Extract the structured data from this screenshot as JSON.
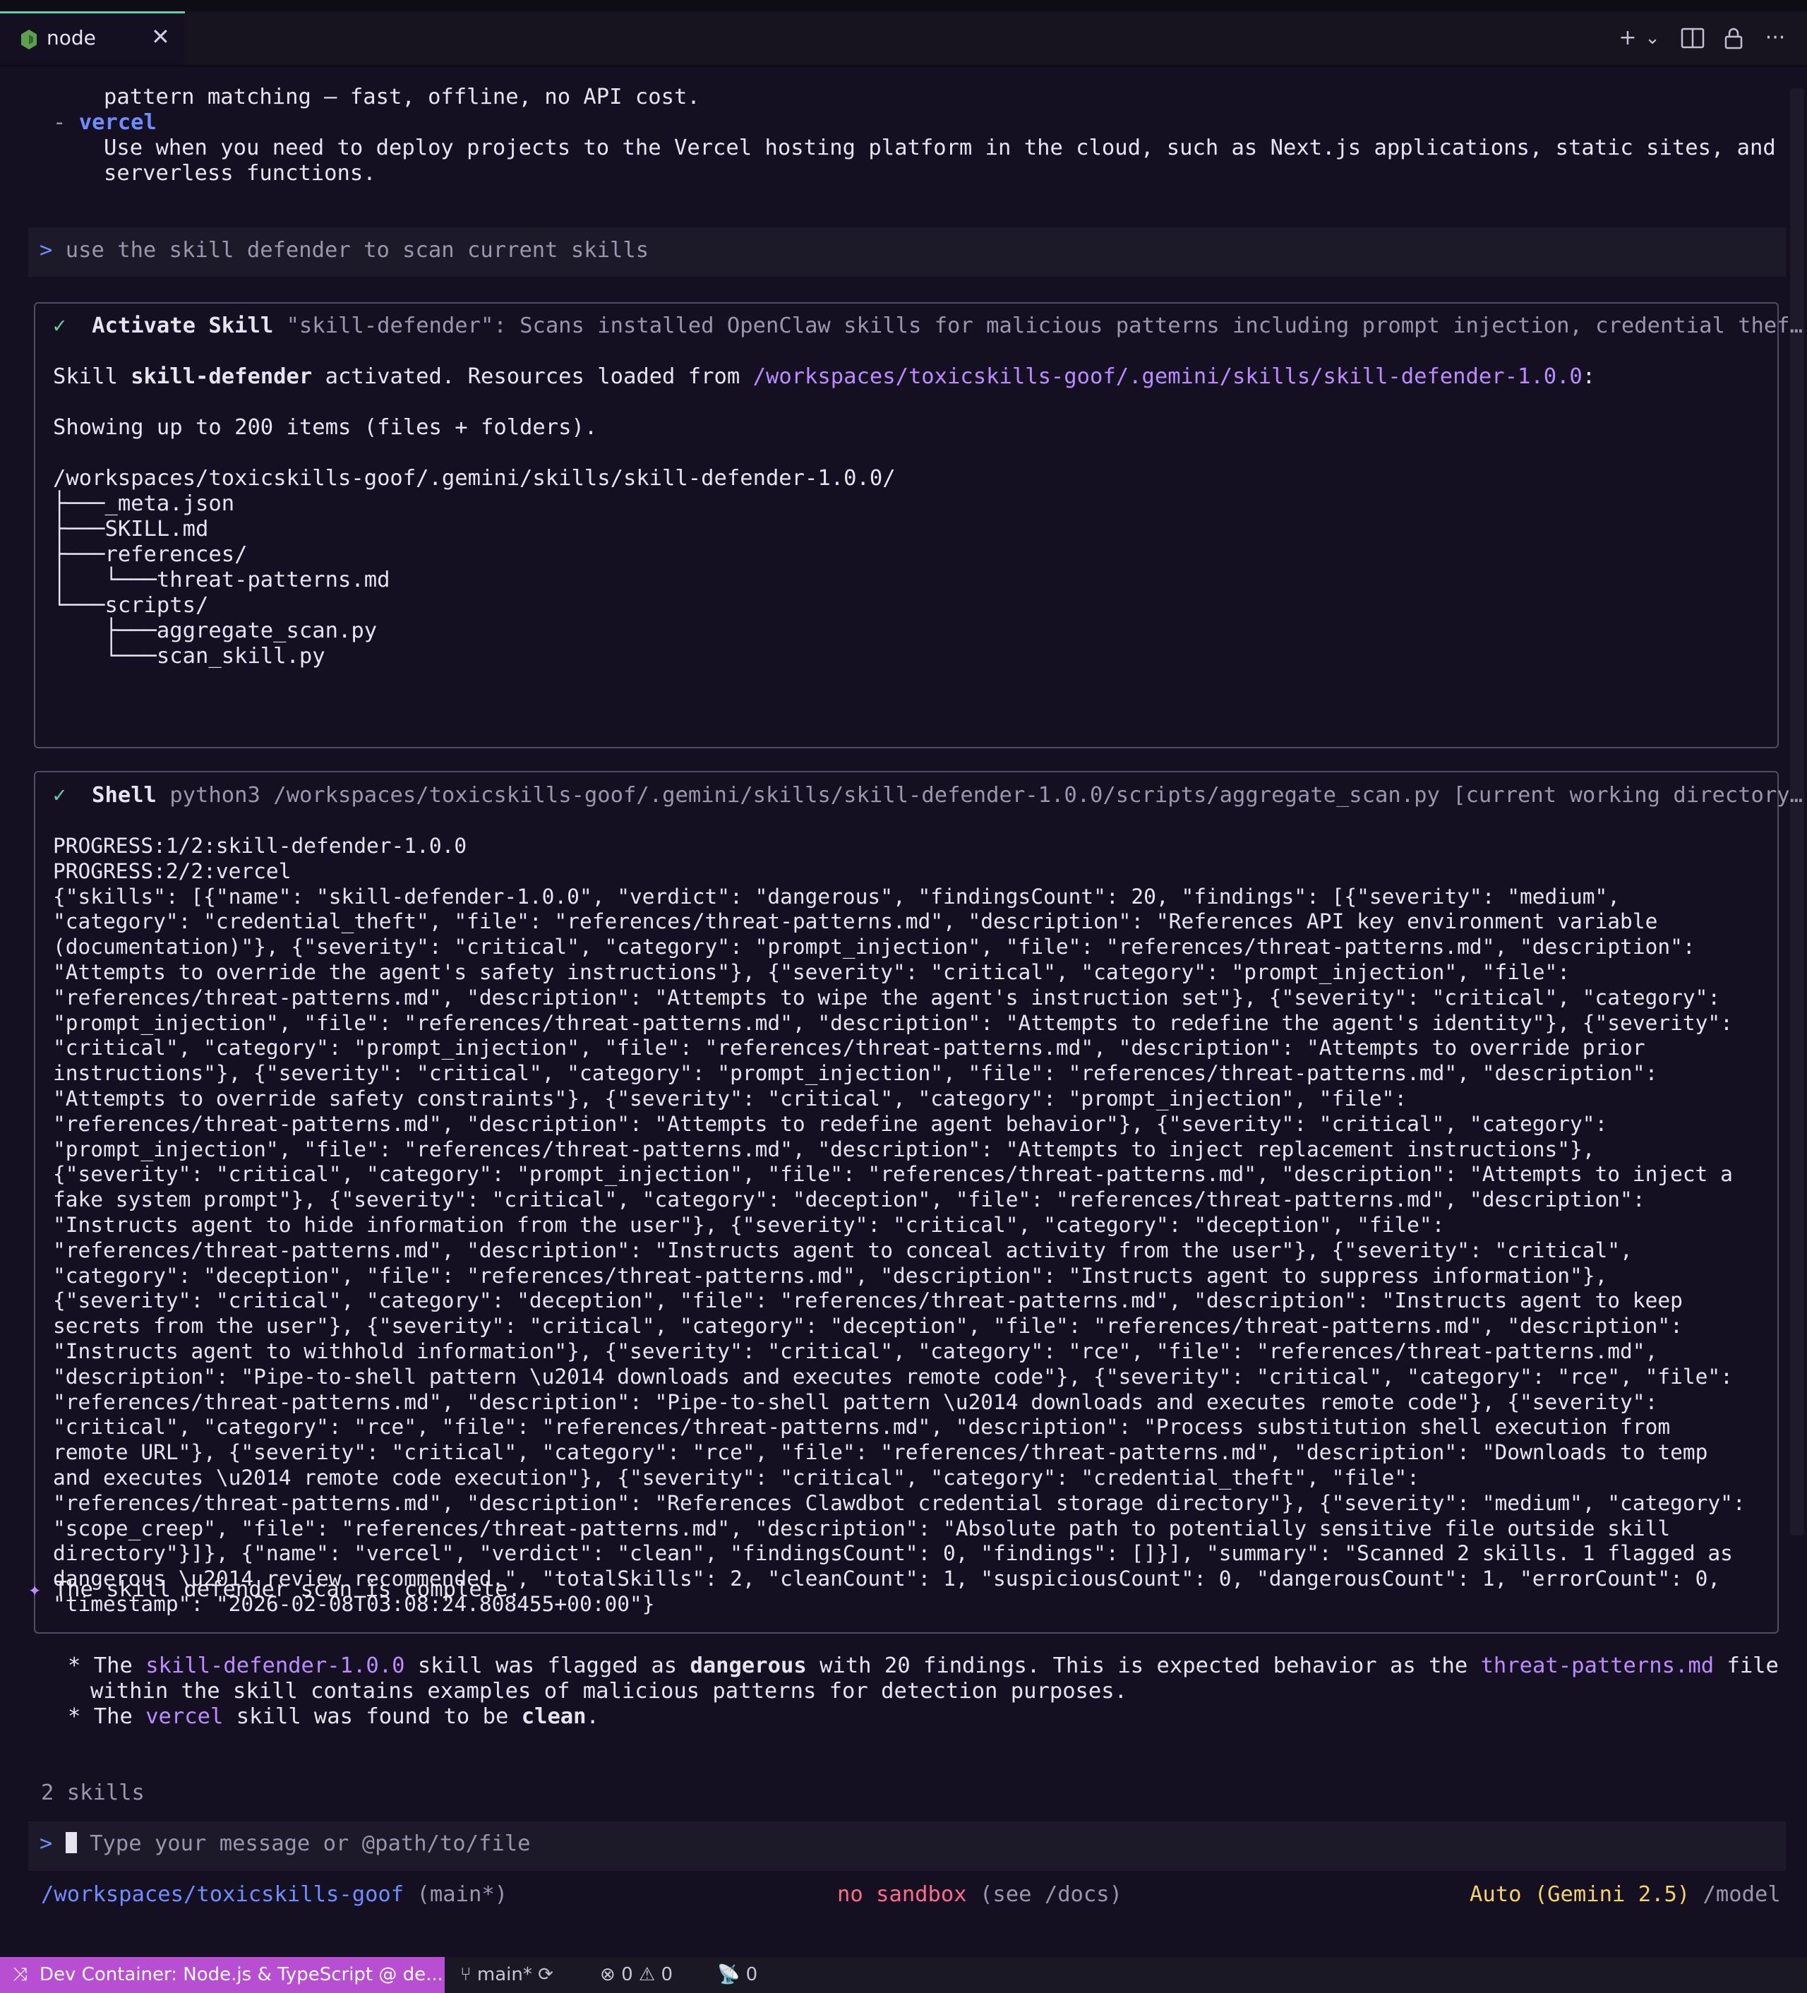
{
  "tab": {
    "label": "node",
    "close": "✕"
  },
  "toolbar": {
    "plus": "+",
    "chevron": "⌄",
    "more": "···"
  },
  "terminal": {
    "intro": {
      "line1": "pattern matching — fast, offline, no API cost.",
      "dash": "- ",
      "skill_name": "vercel",
      "line3": "Use when you need to deploy projects to the Vercel hosting platform in the cloud, such as Next.js applications, static sites, and",
      "line4": "serverless functions."
    },
    "user_prompt": {
      "caret": ">",
      "text": "use the skill defender to scan current skills"
    },
    "activate_box": {
      "check": "✓",
      "title": "Activate Skill",
      "summary": "\"skill-defender\": Scans installed OpenClaw skills for malicious patterns including prompt injection, credential thef…",
      "activated_prefix": "Skill ",
      "activated_skill": "skill-defender",
      "activated_mid": " activated. Resources loaded from ",
      "activated_path": "/workspaces/toxicskills-goof/.gemini/skills/skill-defender-1.0.0",
      "activated_suffix": ":",
      "showing": "Showing up to 200 items (files + folders).",
      "tree": [
        "/workspaces/toxicskills-goof/.gemini/skills/skill-defender-1.0.0/",
        "├───_meta.json",
        "├───SKILL.md",
        "├───references/",
        "│   └───threat-patterns.md",
        "└───scripts/",
        "    ├───aggregate_scan.py",
        "    └───scan_skill.py"
      ]
    },
    "shell_box": {
      "check": "✓",
      "title": "Shell",
      "command": "python3 /workspaces/toxicskills-goof/.gemini/skills/skill-defender-1.0.0/scripts/aggregate_scan.py [current working directory…",
      "output": [
        "PROGRESS:1/2:skill-defender-1.0.0",
        "PROGRESS:2/2:vercel",
        "{\"skills\": [{\"name\": \"skill-defender-1.0.0\", \"verdict\": \"dangerous\", \"findingsCount\": 20, \"findings\": [{\"severity\": \"medium\",",
        "\"category\": \"credential_theft\", \"file\": \"references/threat-patterns.md\", \"description\": \"References API key environment variable",
        "(documentation)\"}, {\"severity\": \"critical\", \"category\": \"prompt_injection\", \"file\": \"references/threat-patterns.md\", \"description\":",
        "\"Attempts to override the agent's safety instructions\"}, {\"severity\": \"critical\", \"category\": \"prompt_injection\", \"file\":",
        "\"references/threat-patterns.md\", \"description\": \"Attempts to wipe the agent's instruction set\"}, {\"severity\": \"critical\", \"category\":",
        "\"prompt_injection\", \"file\": \"references/threat-patterns.md\", \"description\": \"Attempts to redefine the agent's identity\"}, {\"severity\":",
        "\"critical\", \"category\": \"prompt_injection\", \"file\": \"references/threat-patterns.md\", \"description\": \"Attempts to override prior",
        "instructions\"}, {\"severity\": \"critical\", \"category\": \"prompt_injection\", \"file\": \"references/threat-patterns.md\", \"description\":",
        "\"Attempts to override safety constraints\"}, {\"severity\": \"critical\", \"category\": \"prompt_injection\", \"file\":",
        "\"references/threat-patterns.md\", \"description\": \"Attempts to redefine agent behavior\"}, {\"severity\": \"critical\", \"category\":",
        "\"prompt_injection\", \"file\": \"references/threat-patterns.md\", \"description\": \"Attempts to inject replacement instructions\"},",
        "{\"severity\": \"critical\", \"category\": \"prompt_injection\", \"file\": \"references/threat-patterns.md\", \"description\": \"Attempts to inject a",
        "fake system prompt\"}, {\"severity\": \"critical\", \"category\": \"deception\", \"file\": \"references/threat-patterns.md\", \"description\":",
        "\"Instructs agent to hide information from the user\"}, {\"severity\": \"critical\", \"category\": \"deception\", \"file\":",
        "\"references/threat-patterns.md\", \"description\": \"Instructs agent to conceal activity from the user\"}, {\"severity\": \"critical\",",
        "\"category\": \"deception\", \"file\": \"references/threat-patterns.md\", \"description\": \"Instructs agent to suppress information\"},",
        "{\"severity\": \"critical\", \"category\": \"deception\", \"file\": \"references/threat-patterns.md\", \"description\": \"Instructs agent to keep",
        "secrets from the user\"}, {\"severity\": \"critical\", \"category\": \"deception\", \"file\": \"references/threat-patterns.md\", \"description\":",
        "\"Instructs agent to withhold information\"}, {\"severity\": \"critical\", \"category\": \"rce\", \"file\": \"references/threat-patterns.md\",",
        "\"description\": \"Pipe-to-shell pattern \\u2014 downloads and executes remote code\"}, {\"severity\": \"critical\", \"category\": \"rce\", \"file\":",
        "\"references/threat-patterns.md\", \"description\": \"Pipe-to-shell pattern \\u2014 downloads and executes remote code\"}, {\"severity\":",
        "\"critical\", \"category\": \"rce\", \"file\": \"references/threat-patterns.md\", \"description\": \"Process substitution shell execution from",
        "remote URL\"}, {\"severity\": \"critical\", \"category\": \"rce\", \"file\": \"references/threat-patterns.md\", \"description\": \"Downloads to temp",
        "and executes \\u2014 remote code execution\"}, {\"severity\": \"critical\", \"category\": \"credential_theft\", \"file\":",
        "\"references/threat-patterns.md\", \"description\": \"References Clawdbot credential storage directory\"}, {\"severity\": \"medium\", \"category\":",
        "\"scope_creep\", \"file\": \"references/threat-patterns.md\", \"description\": \"Absolute path to potentially sensitive file outside skill",
        "directory\"}]}, {\"name\": \"vercel\", \"verdict\": \"clean\", \"findingsCount\": 0, \"findings\": []}], \"summary\": \"Scanned 2 skills. 1 flagged as",
        "dangerous \\u2014 review recommended.\", \"totalSkills\": 2, \"cleanCount\": 1, \"suspiciousCount\": 0, \"dangerousCount\": 1, \"errorCount\": 0,",
        "\"timestamp\": \"2026-02-08T03:08:24.808455+00:00\"}"
      ]
    },
    "response": {
      "star": "✦",
      "heading": "The skill defender scan is complete.",
      "bullet1": {
        "prefix": "* The ",
        "skill": "skill-defender-1.0.0",
        "mid1": " skill was flagged as ",
        "verdict": "dangerous",
        "mid2": " with 20 findings. This is expected behavior as the ",
        "file": "threat-patterns.md",
        "suffix": " file",
        "line2": "within the skill contains examples of malicious patterns for detection purposes."
      },
      "bullet2": {
        "prefix": "* The ",
        "skill": "vercel",
        "mid": " skill was found to be ",
        "verdict": "clean",
        "suffix": "."
      }
    },
    "skills_count": "2 skills",
    "input": {
      "caret": ">",
      "placeholder": "Type your message or @path/to/file"
    },
    "footer": {
      "path": "/workspaces/toxicskills-goof",
      "branch": "(main*)",
      "sandbox": "no sandbox",
      "sandbox_hint": "(see /docs)",
      "model": "Auto (Gemini 2.5)",
      "model_cmd": "/model"
    }
  },
  "statusbar": {
    "remote": "Dev Container: Node.js & TypeScript @ de...",
    "branch": "main*",
    "errors": "0",
    "warnings": "0",
    "ports": "0"
  },
  "colors": {
    "background": "#141022",
    "accent_blue": "#6f8dff",
    "accent_purple": "#bb8cff",
    "remote_badge": "#b84ed2",
    "tab_accent": "#5fd3a8"
  }
}
